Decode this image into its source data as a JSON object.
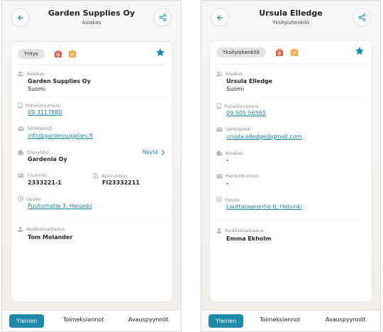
{
  "colors": {
    "accent": "#1c8aa8",
    "link": "#1a84a8",
    "star": "#1c8aa8",
    "badge_red": "#e2543a",
    "badge_orange": "#f0a43a"
  },
  "screens": [
    {
      "title": "Garden Supplies Oy",
      "subtitle": "Asiakas",
      "type_badge": "Yritys",
      "icons": [
        "back-arrow-icon",
        "share-icon",
        "star-icon"
      ],
      "fields": {
        "asiakas": {
          "label": "Asiakas",
          "line1": "Garden Supplies Oy",
          "line2": "Suomi"
        },
        "puhelin": {
          "label": "Puhelinnumero",
          "value": "09 3117880"
        },
        "sahkoposti": {
          "label": "Sähköposti",
          "value": "info@gardensupplies.fi"
        },
        "emoyhtio": {
          "label": "Emoyhtiö",
          "value": "Gardenia Oy",
          "action": "Näytä"
        },
        "ytunnus": {
          "label": "Y-tunnus",
          "value": "2333221-1"
        },
        "alv": {
          "label": "ALV-tunnus",
          "value": "FI23332211"
        },
        "osoite": {
          "label": "Osoite",
          "value": "Puutorhatie 3, Helsinki"
        },
        "vastaava": {
          "label": "Asiakasvastaava",
          "value": "Tom Molander"
        }
      },
      "tabs": [
        "Yleinen",
        "Toimeksiannot",
        "Avauspyynnöt"
      ]
    },
    {
      "title": "Ursula Elledge",
      "subtitle": "Yksityishenkilö",
      "type_badge": "Yksityishenkilö",
      "icons": [
        "back-arrow-icon",
        "share-icon",
        "star-icon"
      ],
      "fields": {
        "asiakas": {
          "label": "Asiakas",
          "line1": "Ursula Elledge",
          "line2": "Suomi"
        },
        "puhelin": {
          "label": "Puhelinnumero",
          "value": "09 505 56565"
        },
        "sahkoposti": {
          "label": "Sähköposti",
          "value": "ursula.elledge@gmail.com"
        },
        "asiakas2": {
          "label": "Asiakas",
          "value": "-"
        },
        "henkilotunnus": {
          "label": "Henkilötunnus",
          "value": "-"
        },
        "osoite": {
          "label": "Osoite",
          "value": "Lauttasaarentie 6, Helsinki"
        },
        "vastaava": {
          "label": "Asiakasvastaava",
          "value": "Emma Ekholm"
        }
      },
      "tabs": [
        "Yleinen",
        "Toimeksiannot",
        "Avauspyynnöt"
      ]
    }
  ]
}
